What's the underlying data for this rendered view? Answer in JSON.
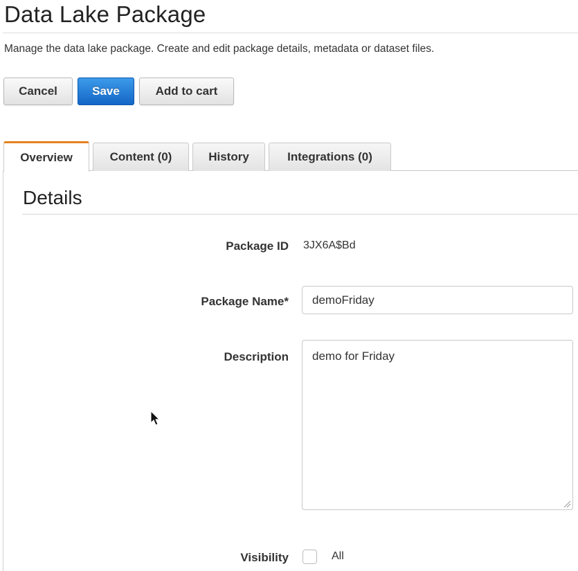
{
  "header": {
    "title": "Data Lake Package",
    "subtitle": "Manage the data lake package. Create and edit package details, metadata or dataset files."
  },
  "toolbar": {
    "cancel_label": "Cancel",
    "save_label": "Save",
    "add_to_cart_label": "Add to cart"
  },
  "tabs": [
    {
      "label": "Overview",
      "active": true
    },
    {
      "label": "Content (0)",
      "active": false
    },
    {
      "label": "History",
      "active": false
    },
    {
      "label": "Integrations (0)",
      "active": false
    }
  ],
  "details": {
    "section_title": "Details",
    "package_id_label": "Package ID",
    "package_id_value": "3JX6A$Bd",
    "package_name_label": "Package Name*",
    "package_name_value": "demoFriday",
    "description_label": "Description",
    "description_value": "demo for Friday",
    "visibility_label": "Visibility",
    "visibility_option_label": "All",
    "visibility_all_checked": false
  },
  "colors": {
    "primary_button": "#1f74d4",
    "active_tab_accent": "#e5821e",
    "border": "#c8c8c8"
  },
  "icons": {
    "cursor": "mouse-pointer-icon",
    "resize": "resize-grip-icon"
  }
}
